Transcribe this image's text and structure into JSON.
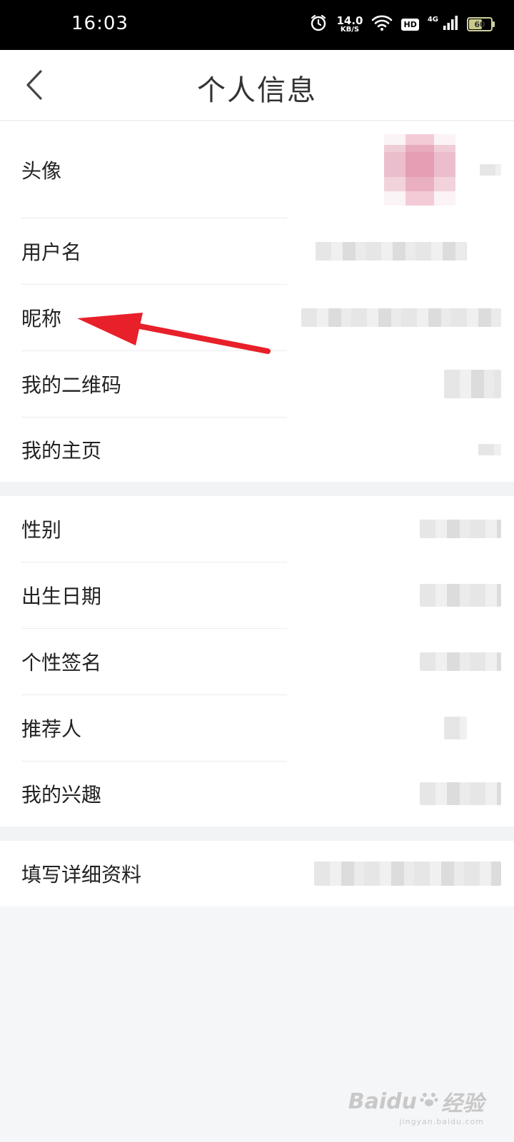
{
  "status_bar": {
    "time": "16:03",
    "net_speed_value": "14.0",
    "net_speed_unit": "KB/S",
    "hd_label": "HD",
    "network_label": "4G",
    "battery_percent": 60,
    "battery_label": "60",
    "icons": [
      "alarm-icon",
      "wifi-icon",
      "signal-icon",
      "battery-icon"
    ]
  },
  "nav": {
    "back_icon": "chevron-left-icon",
    "title": "个人信息"
  },
  "sections": [
    {
      "rows": [
        {
          "label": "头像",
          "value_type": "avatar"
        },
        {
          "label": "用户名",
          "value_type": "blurred"
        },
        {
          "label": "昵称",
          "value_type": "blurred"
        },
        {
          "label": "我的二维码",
          "value_type": "blurred"
        },
        {
          "label": "我的主页",
          "value_type": "blurred"
        }
      ]
    },
    {
      "rows": [
        {
          "label": "性别",
          "value_type": "blurred"
        },
        {
          "label": "出生日期",
          "value_type": "blurred"
        },
        {
          "label": "个性签名",
          "value_type": "blurred"
        },
        {
          "label": "推荐人",
          "value_type": "blurred"
        },
        {
          "label": "我的兴趣",
          "value_type": "blurred"
        }
      ]
    },
    {
      "rows": [
        {
          "label": "填写详细资料",
          "value_type": "blurred"
        }
      ]
    }
  ],
  "annotation": {
    "type": "red-arrow",
    "color": "#e8202a",
    "points_to": "昵称"
  },
  "watermark": {
    "brand": "Baidu",
    "text": "经验",
    "sub": "jingyan.baidu.com"
  },
  "colors": {
    "background": "#f5f6f8",
    "card": "#ffffff",
    "title": "#333333",
    "label": "#222222",
    "arrow": "#e8202a"
  }
}
